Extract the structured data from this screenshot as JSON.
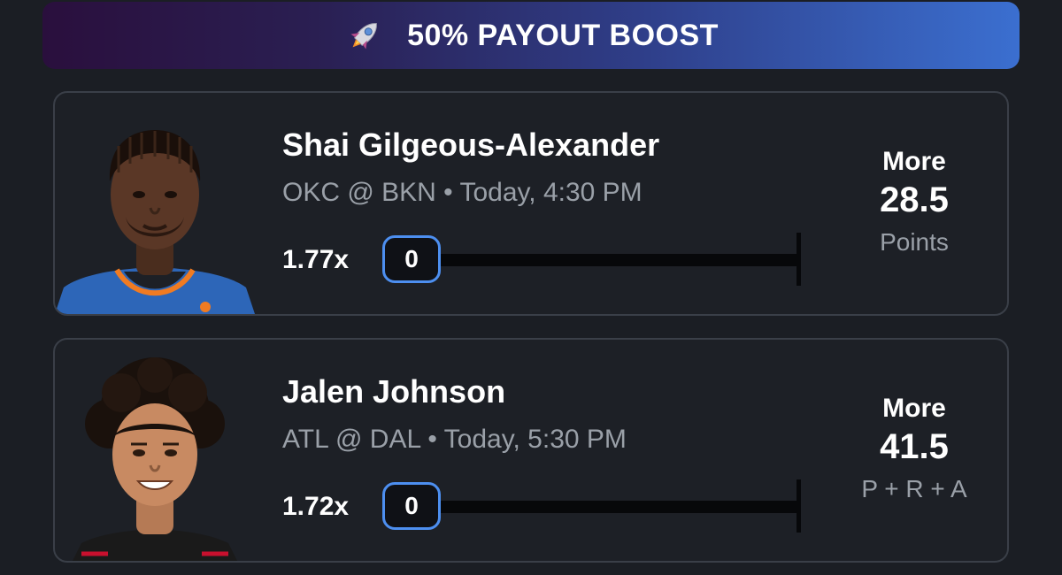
{
  "banner": {
    "icon": "rocket-icon",
    "text": "50% PAYOUT BOOST"
  },
  "picks": [
    {
      "player_name": "Shai Gilgeous-Alexander",
      "matchup": "OKC @ BKN • Today, 4:30 PM",
      "multiplier": "1.77x",
      "count": "0",
      "direction": "More",
      "line": "28.5",
      "stat": "Points",
      "jersey_color": "#2d66b8"
    },
    {
      "player_name": "Jalen Johnson",
      "matchup": "ATL @ DAL • Today, 5:30 PM",
      "multiplier": "1.72x",
      "count": "0",
      "direction": "More",
      "line": "41.5",
      "stat": "P + R + A",
      "jersey_color": "#1a1a1a"
    }
  ],
  "colors": {
    "background": "#1b1e24",
    "card_border": "#3a3f48",
    "accent_blue": "#4d8ff0",
    "muted_text": "#9aa0a8"
  }
}
